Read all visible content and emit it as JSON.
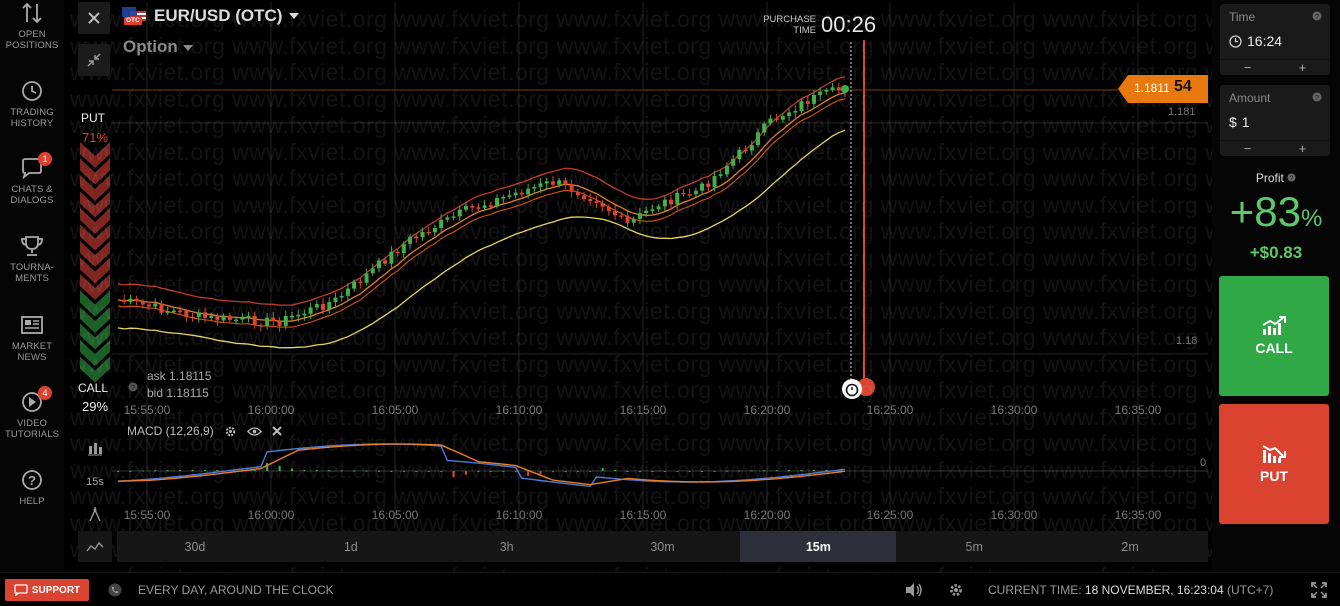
{
  "nav": [
    {
      "label": "OPEN\nPOSITIONS",
      "icon": "arrows-updown-icon"
    },
    {
      "label": "TRADING\nHISTORY",
      "icon": "history-icon"
    },
    {
      "label": "CHATS &\nDIALOGS",
      "icon": "chat-icon",
      "badge": "1"
    },
    {
      "label": "TOURNA-\nMENTS",
      "icon": "trophy-icon"
    },
    {
      "label": "MARKET\nNEWS",
      "icon": "news-icon"
    },
    {
      "label": "VIDEO\nTUTORIALS",
      "icon": "play-icon",
      "badge": "4"
    },
    {
      "label": "HELP",
      "icon": "help-icon"
    }
  ],
  "header": {
    "asset": "EUR/USD (OTC)",
    "flag_badge": "OTC",
    "option": "Option",
    "purchase_label": "PURCHASE\nTIME",
    "purchase_time": "00:26"
  },
  "sentiment": {
    "put_label": "PUT",
    "put_pct": "71%",
    "call_label": "CALL",
    "call_pct": "29%"
  },
  "quote": {
    "ask": "ask 1.18115",
    "bid": "bid 1.18115",
    "price_prefix": "1.1811",
    "price_suffix": "54"
  },
  "price_axis": [
    "1.181",
    "1.18"
  ],
  "macd": {
    "label": "MACD (12,26,9)",
    "zero": "0"
  },
  "side_tools": {
    "interval": "15s"
  },
  "time_axis": [
    "15:55:00",
    "16:00:00",
    "16:05:00",
    "16:10:00",
    "16:15:00",
    "16:20:00",
    "16:25:00",
    "16:30:00",
    "16:35:00"
  ],
  "timeframes": [
    {
      "label": "30d",
      "active": false
    },
    {
      "label": "1d",
      "active": false
    },
    {
      "label": "3h",
      "active": false
    },
    {
      "label": "30m",
      "active": false
    },
    {
      "label": "15m",
      "active": true
    },
    {
      "label": "5m",
      "active": false
    },
    {
      "label": "2m",
      "active": false
    }
  ],
  "trade": {
    "time_label": "Time",
    "time_value": "16:24",
    "amount_label": "Amount",
    "amount_currency": "$",
    "amount_value": "1",
    "minus": "−",
    "plus": "+",
    "profit_label": "Profit",
    "profit_pct": "+83",
    "profit_pct_sign": "%",
    "profit_amount": "+$0.83",
    "call_label": "CALL",
    "put_label": "PUT"
  },
  "footer": {
    "support": "SUPPORT",
    "slogan": "EVERY DAY, AROUND THE CLOCK",
    "current_time_label": "CURRENT TIME:",
    "current_time_value": "18 NOVEMBER, 16:23:04",
    "tz": "(UTC+7)"
  },
  "watermark": "www.fxviet.org",
  "colors": {
    "call": "#2fa845",
    "put": "#d9432f",
    "accent_orange": "#e8790f",
    "profit": "#5cc96b"
  }
}
